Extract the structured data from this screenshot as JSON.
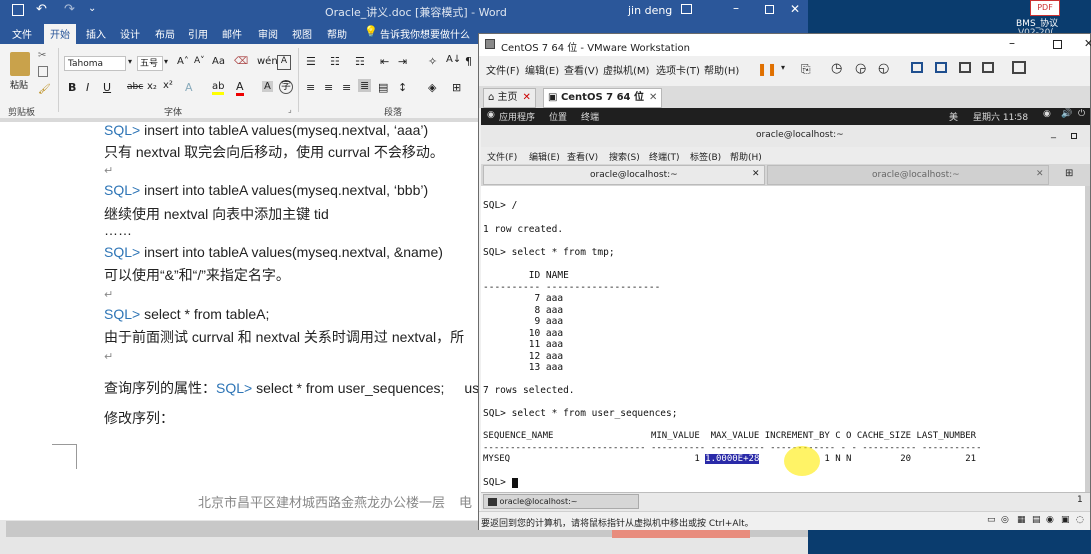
{
  "word": {
    "title": "Oracle_讲义.doc [兼容模式]  -  Word",
    "user": "jin deng",
    "tabs": [
      "文件",
      "开始",
      "插入",
      "设计",
      "布局",
      "引用",
      "邮件",
      "审阅",
      "视图",
      "帮助"
    ],
    "tell_me": "告诉我你想要做什么",
    "font_name": "Tahoma",
    "font_size": "五号",
    "groups": {
      "clipboard": "剪贴板",
      "font": "字体",
      "paragraph": "段落"
    },
    "paste_label": "粘贴",
    "doc_lines": [
      {
        "kw": "SQL>",
        "text": "   insert into tableA values(myseq.nextval,  ‘aaa’)"
      },
      {
        "kw": "",
        "text": "只有 nextval 取完会向后移动，使用 currval 不会移动。"
      },
      {
        "kw": "SQL>",
        "text": "   insert into tableA values(myseq.nextval,  ‘bbb’)"
      },
      {
        "kw": "",
        "text": "继续使用 nextval 向表中添加主键 tid"
      },
      {
        "kw": "",
        "text": "……"
      },
      {
        "kw": "SQL>",
        "text": "   insert into tableA values(myseq.nextval, &name)"
      },
      {
        "kw": "",
        "text": "可以使用“&”和“/”来指定名字。"
      },
      {
        "kw": "SQL>",
        "text": " select * from tableA;"
      },
      {
        "kw": "",
        "text": "    由于前面测试 currval 和 nextval 关系时调用过 nextval，所"
      },
      {
        "kw": "",
        "text": "查询序列的属性："
      },
      {
        "kw": "",
        "text": "修改序列："
      }
    ],
    "query_kw": "SQL>",
    "query_text": " select * from user_sequences;",
    "query_trunc": "use",
    "footer": "北京市昌平区建材城西路金燕龙办公楼一层",
    "footer_trunc": "电"
  },
  "desktop": {
    "icon_label": "BMS_协议",
    "icon_sub": "V02-20(",
    "pdf_badge": "PDF"
  },
  "vmware": {
    "title": "CentOS 7 64 位 - VMware Workstation",
    "menu": [
      "文件(F)",
      "编辑(E)",
      "查看(V)",
      "虚拟机(M)",
      "选项卡(T)",
      "帮助(H)"
    ],
    "tabs": [
      "主页",
      "CentOS 7 64 位"
    ],
    "status_text": "要返回到您的计算机，请将鼠标指针从虚拟机中移出或按 Ctrl+Alt。",
    "taskbar_item": "oracle@localhost:~",
    "taskbar_page": "1"
  },
  "gnome": {
    "apps": "应用程序",
    "places": "位置",
    "terminal": "终端",
    "lang": "美",
    "clock": "星期六 11∶58"
  },
  "terminal": {
    "title": "oracle@localhost:~",
    "menu": [
      "文件(F)",
      "编辑(E)",
      "查看(V)",
      "搜索(S)",
      "终端(T)",
      "标签(B)",
      "帮助(H)"
    ],
    "tab_active": "oracle@localhost:~",
    "tab_inactive": "oracle@localhost:~",
    "lines": [
      "SQL> /",
      "",
      "1 row created.",
      "",
      "SQL> select * from tmp;",
      "",
      "        ID NAME",
      "---------- --------------------",
      "         7 aaa",
      "         8 aaa",
      "         9 aaa",
      "        10 aaa",
      "        11 aaa",
      "        12 aaa",
      "        13 aaa",
      "",
      "7 rows selected.",
      "",
      "SQL> select * from user_sequences;",
      "",
      "SEQUENCE_NAME                  MIN_VALUE  MAX_VALUE INCREMENT_BY C O CACHE_SIZE LAST_NUMBER",
      "------------------------------ ---------- ---------- ------------ - - ---------- -----------",
      "MYSEQ                                  1 ",
      "",
      "SQL> "
    ],
    "highlight_value": "1.0000E+28",
    "row_rest": "            1 N N         20          21"
  }
}
